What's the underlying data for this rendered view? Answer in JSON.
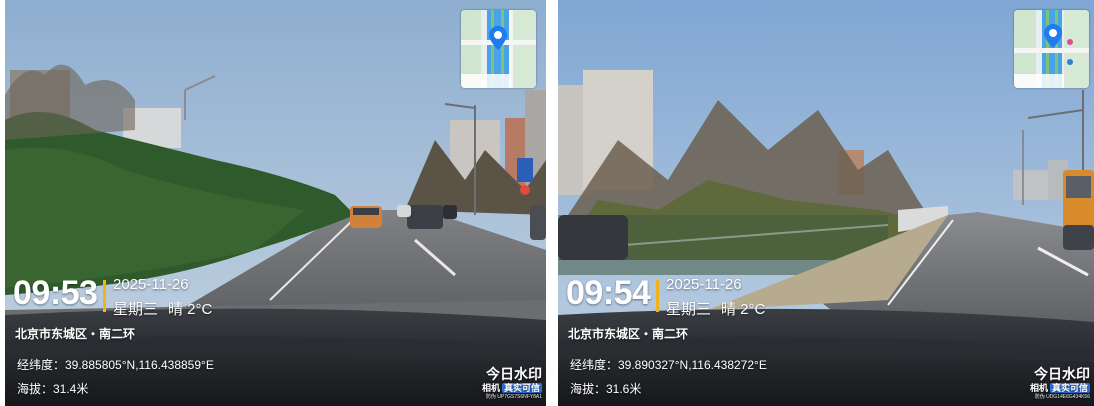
{
  "panels": [
    {
      "time": "09:53",
      "date": "2025-11-26",
      "weekday": "星期三",
      "weather": "晴 2°C",
      "location": "北京市东城区・南二环",
      "coords": "经纬度：39.885805°N,116.438859°E",
      "altitude": "海拔：31.4米",
      "brand_title": "今日水印",
      "brand_sub": "相机",
      "brand_badge": "真实可信",
      "brand_code": "防伪 UP7GS7S6NFY8A1"
    },
    {
      "time": "09:54",
      "date": "2025-11-26",
      "weekday": "星期三",
      "weather": "晴 2°C",
      "location": "北京市东城区・南二环",
      "coords": "经纬度：39.890327°N,116.438272°E",
      "altitude": "海拔：31.6米",
      "brand_title": "今日水印",
      "brand_sub": "相机",
      "brand_badge": "真实可信",
      "brand_code": "防伪 UDG14E6G434K56"
    }
  ],
  "colors": {
    "accent_bar": "#f2b21a",
    "sky": "#9fb9d6",
    "map_pin": "#1e7cf0"
  },
  "icons": [
    "map-pin-icon"
  ]
}
